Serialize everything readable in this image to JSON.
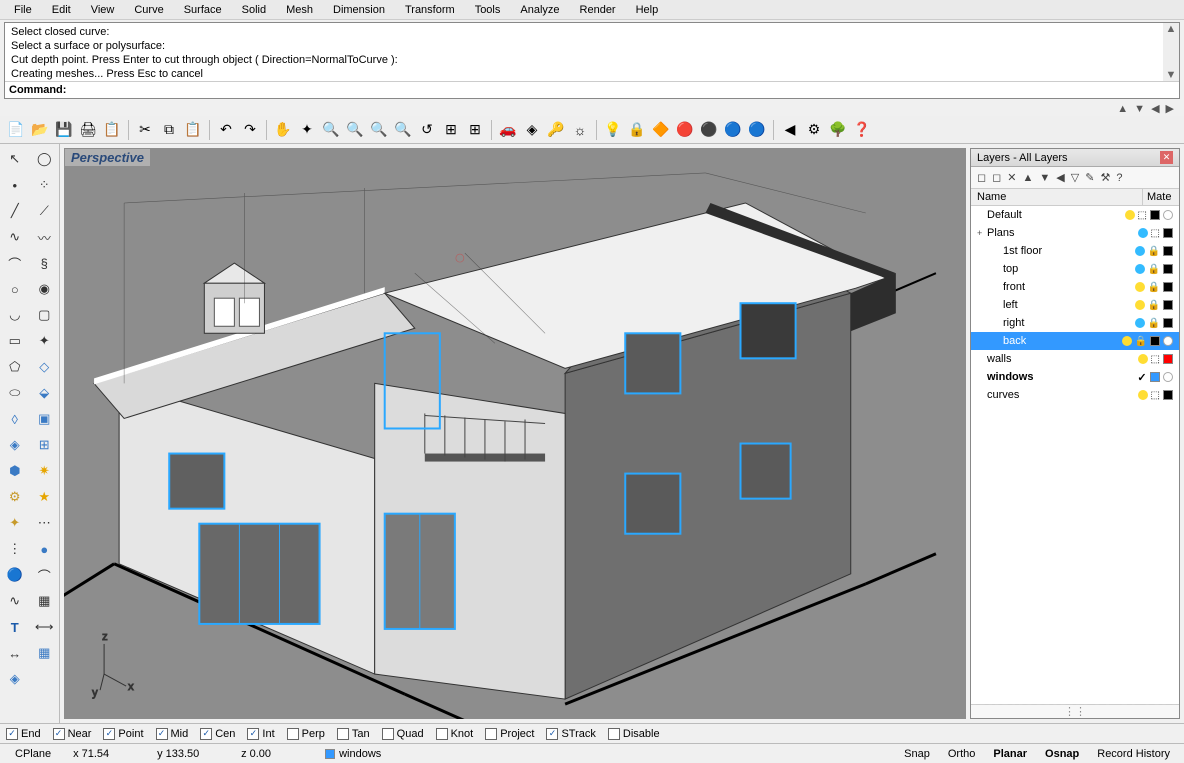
{
  "menu": [
    "File",
    "Edit",
    "View",
    "Curve",
    "Surface",
    "Solid",
    "Mesh",
    "Dimension",
    "Transform",
    "Tools",
    "Analyze",
    "Render",
    "Help"
  ],
  "command_history": [
    "Select closed curve:",
    "Select a surface or polysurface:",
    "Cut depth point. Press Enter to cut through object ( Direction=NormalToCurve ):",
    "Creating meshes... Press Esc to cancel"
  ],
  "command_label": "Command:",
  "viewport_title": "Perspective",
  "layers_panel": {
    "title": "Layers - All Layers",
    "columns": {
      "name": "Name",
      "mate": "Mate"
    },
    "rows": [
      {
        "name": "Default",
        "indent": 0,
        "bulb": "#ffdd33",
        "lock": "open",
        "color": "#000000",
        "mat": true
      },
      {
        "name": "Plans",
        "indent": 0,
        "expand": "+",
        "bulb": "#33bbff",
        "lock": "open",
        "color": "#000000"
      },
      {
        "name": "1st floor",
        "indent": 1,
        "bulb": "#33bbff",
        "lock": "closed",
        "color": "#000000"
      },
      {
        "name": "top",
        "indent": 1,
        "bulb": "#33bbff",
        "lock": "closed",
        "color": "#000000"
      },
      {
        "name": "front",
        "indent": 1,
        "bulb": "#ffdd33",
        "lock": "closed",
        "color": "#000000"
      },
      {
        "name": "left",
        "indent": 1,
        "bulb": "#ffdd33",
        "lock": "closed",
        "color": "#000000"
      },
      {
        "name": "right",
        "indent": 1,
        "bulb": "#33bbff",
        "lock": "closed",
        "color": "#000000"
      },
      {
        "name": "back",
        "indent": 1,
        "selected": true,
        "bulb": "#ffdd33",
        "lock": "closed",
        "color": "#000000",
        "mat": true
      },
      {
        "name": "walls",
        "indent": 0,
        "bulb": "#ffdd33",
        "lock": "open",
        "color": "#ff0000"
      },
      {
        "name": "windows",
        "indent": 0,
        "bold": true,
        "check": true,
        "color": "#3399ff",
        "mat": true
      },
      {
        "name": "curves",
        "indent": 0,
        "bulb": "#ffdd33",
        "lock": "open",
        "color": "#000000"
      }
    ]
  },
  "osnap": [
    {
      "label": "End",
      "checked": true
    },
    {
      "label": "Near",
      "checked": true
    },
    {
      "label": "Point",
      "checked": true
    },
    {
      "label": "Mid",
      "checked": true
    },
    {
      "label": "Cen",
      "checked": true
    },
    {
      "label": "Int",
      "checked": true
    },
    {
      "label": "Perp",
      "checked": false
    },
    {
      "label": "Tan",
      "checked": false
    },
    {
      "label": "Quad",
      "checked": false
    },
    {
      "label": "Knot",
      "checked": false
    },
    {
      "label": "Project",
      "checked": false
    },
    {
      "label": "STrack",
      "checked": true
    },
    {
      "label": "Disable",
      "checked": false
    }
  ],
  "status": {
    "cplane": "CPlane",
    "x": "x 71.54",
    "y": "y 133.50",
    "z": "z 0.00",
    "layer": "windows",
    "layer_color": "#3399ff",
    "toggles": [
      {
        "label": "Snap",
        "active": false
      },
      {
        "label": "Ortho",
        "active": false
      },
      {
        "label": "Planar",
        "active": true
      },
      {
        "label": "Osnap",
        "active": true
      },
      {
        "label": "Record History",
        "active": false
      }
    ]
  },
  "axis": {
    "z": "z",
    "y": "y",
    "x": "x"
  }
}
